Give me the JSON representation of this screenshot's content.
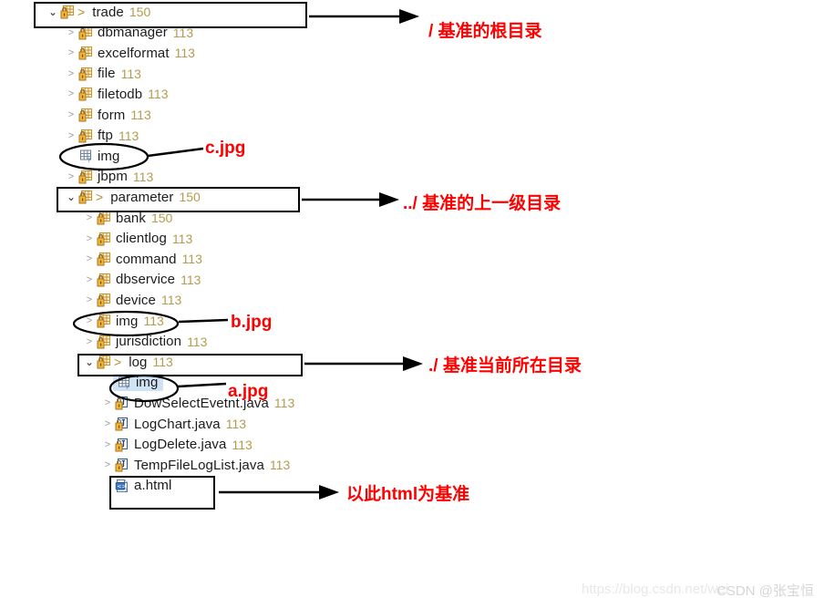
{
  "tree": {
    "rows": [
      {
        "id": "trade",
        "label": "trade",
        "count": "150",
        "indent": 0,
        "twisty": "open",
        "gt": true,
        "icon": "package-locked-icon",
        "selected": false
      },
      {
        "id": "dbmanager",
        "label": "dbmanager",
        "count": "113",
        "indent": 1,
        "twisty": "collapsed",
        "gt": false,
        "icon": "package-locked-icon",
        "selected": false
      },
      {
        "id": "excelformat",
        "label": "excelformat",
        "count": "113",
        "indent": 1,
        "twisty": "collapsed",
        "gt": false,
        "icon": "package-locked-icon",
        "selected": false
      },
      {
        "id": "file",
        "label": "file",
        "count": "113",
        "indent": 1,
        "twisty": "collapsed",
        "gt": false,
        "icon": "package-locked-icon",
        "selected": false
      },
      {
        "id": "filetodb",
        "label": "filetodb",
        "count": "113",
        "indent": 1,
        "twisty": "collapsed",
        "gt": false,
        "icon": "package-locked-icon",
        "selected": false
      },
      {
        "id": "form",
        "label": "form",
        "count": "113",
        "indent": 1,
        "twisty": "collapsed",
        "gt": false,
        "icon": "package-locked-icon",
        "selected": false
      },
      {
        "id": "ftp",
        "label": "ftp",
        "count": "113",
        "indent": 1,
        "twisty": "collapsed",
        "gt": false,
        "icon": "package-locked-icon",
        "selected": false
      },
      {
        "id": "img-trade",
        "label": "img",
        "count": "",
        "indent": 1,
        "twisty": "none",
        "gt": false,
        "icon": "package-empty-icon",
        "selected": false
      },
      {
        "id": "jbpm",
        "label": "jbpm",
        "count": "113",
        "indent": 1,
        "twisty": "collapsed",
        "gt": false,
        "icon": "package-locked-icon",
        "selected": false
      },
      {
        "id": "parameter",
        "label": "parameter",
        "count": "150",
        "indent": 1,
        "twisty": "open",
        "gt": true,
        "icon": "package-locked-icon",
        "selected": false
      },
      {
        "id": "bank",
        "label": "bank",
        "count": "150",
        "indent": 2,
        "twisty": "collapsed",
        "gt": false,
        "icon": "package-locked-icon",
        "selected": false
      },
      {
        "id": "clientlog",
        "label": "clientlog",
        "count": "113",
        "indent": 2,
        "twisty": "collapsed",
        "gt": false,
        "icon": "package-locked-icon",
        "selected": false
      },
      {
        "id": "command",
        "label": "command",
        "count": "113",
        "indent": 2,
        "twisty": "collapsed",
        "gt": false,
        "icon": "package-locked-icon",
        "selected": false
      },
      {
        "id": "dbservice",
        "label": "dbservice",
        "count": "113",
        "indent": 2,
        "twisty": "collapsed",
        "gt": false,
        "icon": "package-locked-icon",
        "selected": false
      },
      {
        "id": "device",
        "label": "device",
        "count": "113",
        "indent": 2,
        "twisty": "collapsed",
        "gt": false,
        "icon": "package-locked-icon",
        "selected": false
      },
      {
        "id": "img-parameter",
        "label": "img",
        "count": "113",
        "indent": 2,
        "twisty": "collapsed",
        "gt": false,
        "icon": "package-locked-icon",
        "selected": false
      },
      {
        "id": "jurisdiction",
        "label": "jurisdiction",
        "count": "113",
        "indent": 2,
        "twisty": "collapsed",
        "gt": false,
        "icon": "package-locked-icon",
        "selected": false
      },
      {
        "id": "log",
        "label": "log",
        "count": "113",
        "indent": 2,
        "twisty": "open",
        "gt": true,
        "icon": "package-locked-icon",
        "selected": false
      },
      {
        "id": "img-log",
        "label": "img",
        "count": "",
        "indent": 3,
        "twisty": "none",
        "gt": false,
        "icon": "package-empty-icon",
        "selected": true
      },
      {
        "id": "DowSelectEvetnt",
        "label": "DowSelectEvetnt.java",
        "count": "113",
        "indent": 3,
        "twisty": "collapsed",
        "gt": false,
        "icon": "java-locked-icon",
        "selected": false
      },
      {
        "id": "LogChart",
        "label": "LogChart.java",
        "count": "113",
        "indent": 3,
        "twisty": "collapsed",
        "gt": false,
        "icon": "java-locked-icon",
        "selected": false
      },
      {
        "id": "LogDelete",
        "label": "LogDelete.java",
        "count": "113",
        "indent": 3,
        "twisty": "collapsed",
        "gt": false,
        "icon": "java-locked-icon",
        "selected": false
      },
      {
        "id": "TempFileLogList",
        "label": "TempFileLogList.java",
        "count": "113",
        "indent": 3,
        "twisty": "collapsed",
        "gt": false,
        "icon": "java-locked-icon",
        "selected": false
      },
      {
        "id": "a-html",
        "label": "a.html",
        "count": "",
        "indent": 3,
        "twisty": "none",
        "gt": false,
        "icon": "html-file-icon",
        "selected": false
      }
    ]
  },
  "annotations": {
    "root_dir": "/ 基准的根目录",
    "parent_dir": "../ 基准的上一级目录",
    "current_dir": "./ 基准当前所在目录",
    "base_html": "以此html为基准",
    "c_jpg": "c.jpg",
    "b_jpg": "b.jpg",
    "a_jpg": "a.jpg"
  },
  "watermarks": {
    "url": "https://blog.csdn.net/wei",
    "handle": "CSDN @张宝恒"
  },
  "colors": {
    "annotation_red": "#ff0000",
    "count_gold": "#b59b4d",
    "selection_blue": "#cfe3f5",
    "callout_black": "#000000"
  }
}
